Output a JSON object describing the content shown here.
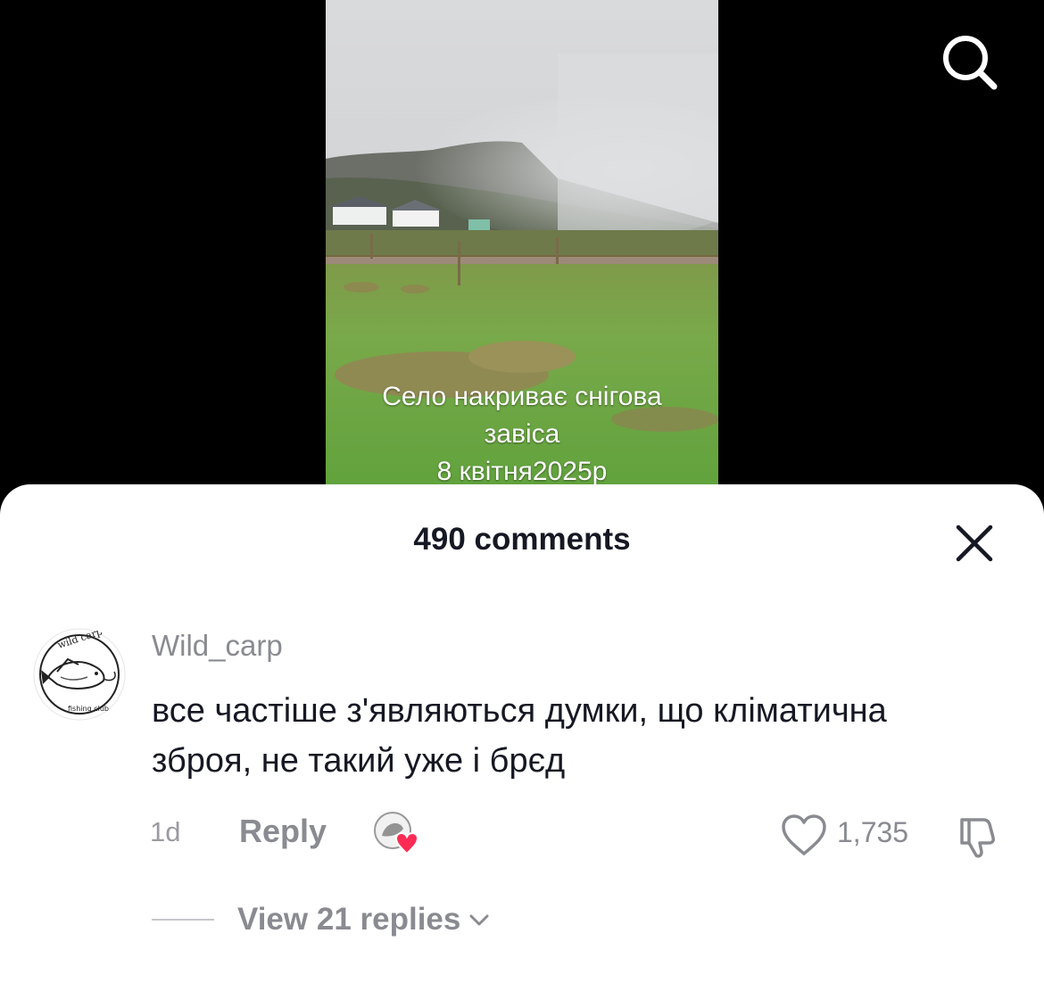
{
  "video": {
    "caption_line1": "Село накриває снігова",
    "caption_line2": "завіса",
    "caption_line3": "8 квітня2025р"
  },
  "icons": {
    "search": "search-icon",
    "close": "close-icon",
    "like": "heart-outline-icon",
    "dislike": "thumbs-down-icon",
    "chevron": "chevron-down-icon"
  },
  "comments_sheet": {
    "title": "490 comments",
    "comment": {
      "username": "Wild_carp",
      "avatar_text_top": "wild carp",
      "avatar_text_bottom": "fishing club",
      "text": "все частіше з'являються думки, що кліматична зброя, не такий уже і брєд",
      "time": "1d",
      "reply_label": "Reply",
      "likes": "1,735",
      "view_replies": "View 21 replies"
    }
  },
  "colors": {
    "sheet_bg": "#ffffff",
    "text_primary": "#161823",
    "text_secondary": "#8a8b91",
    "heart_red": "#fe2c55"
  }
}
